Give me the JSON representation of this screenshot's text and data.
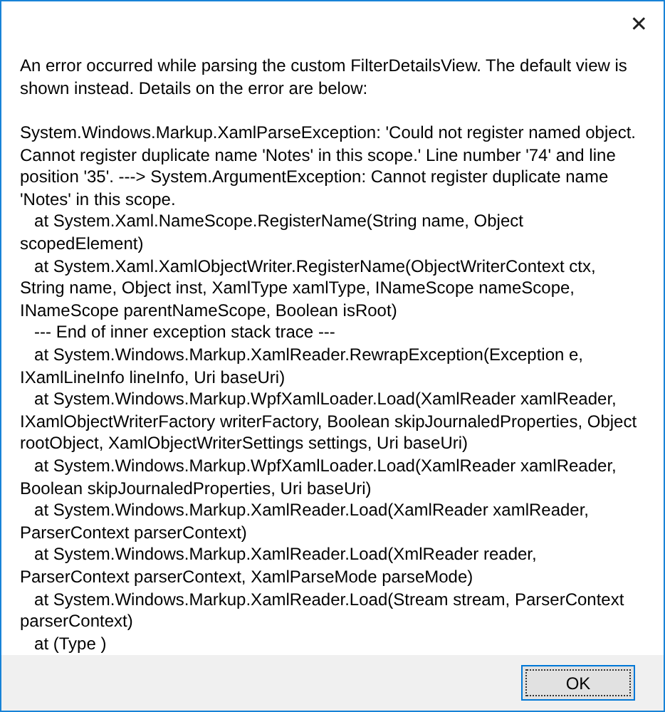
{
  "window": {
    "close": "✕"
  },
  "message": "An error occurred while parsing the custom FilterDetailsView. The default view is shown instead. Details on the error are below:",
  "details": "System.Windows.Markup.XamlParseException: 'Could not register named object. Cannot register duplicate name 'Notes' in this scope.' Line number '74' and line position '35'. ---> System.ArgumentException: Cannot register duplicate name 'Notes' in this scope.\n   at System.Xaml.NameScope.RegisterName(String name, Object scopedElement)\n   at System.Xaml.XamlObjectWriter.RegisterName(ObjectWriterContext ctx, String name, Object inst, XamlType xamlType, INameScope nameScope, INameScope parentNameScope, Boolean isRoot)\n   --- End of inner exception stack trace ---\n   at System.Windows.Markup.XamlReader.RewrapException(Exception e, IXamlLineInfo lineInfo, Uri baseUri)\n   at System.Windows.Markup.WpfXamlLoader.Load(XamlReader xamlReader, IXamlObjectWriterFactory writerFactory, Boolean skipJournaledProperties, Object rootObject, XamlObjectWriterSettings settings, Uri baseUri)\n   at System.Windows.Markup.WpfXamlLoader.Load(XamlReader xamlReader, Boolean skipJournaledProperties, Uri baseUri)\n   at System.Windows.Markup.XamlReader.Load(XamlReader xamlReader, ParserContext parserContext)\n   at System.Windows.Markup.XamlReader.Load(XmlReader reader, ParserContext parserContext, XamlParseMode parseMode)\n   at System.Windows.Markup.XamlReader.Load(Stream stream, ParserContext parserContext)\n   at (Type )",
  "buttons": [
    "OK"
  ]
}
